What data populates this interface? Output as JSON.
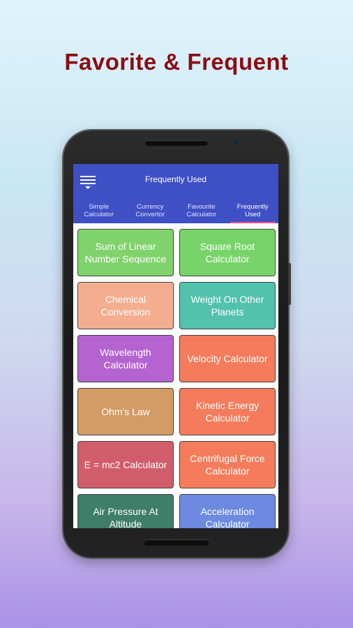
{
  "promo": {
    "title": "Favorite & Frequent"
  },
  "appbar": {
    "title": "Frequently Used",
    "menu_icon": "menu-icon"
  },
  "tabs": [
    {
      "line1": "Simple",
      "line2": "Calculator",
      "active": false
    },
    {
      "line1": "Currency",
      "line2": "Convertor",
      "active": false
    },
    {
      "line1": "Favourite",
      "line2": "Calculator",
      "active": false
    },
    {
      "line1": "Frequently",
      "line2": "Used",
      "active": true
    }
  ],
  "tiles": [
    {
      "label": "Sum of Linear Number Sequence",
      "color": "#7fd36a"
    },
    {
      "label": "Square Root Calculator",
      "color": "#78d46a"
    },
    {
      "label": "Chemical Conversion",
      "color": "#f5ad8f"
    },
    {
      "label": "Weight On Other Planets",
      "color": "#52c2ad"
    },
    {
      "label": "Wavelength Calculator",
      "color": "#b463d0"
    },
    {
      "label": "Velocity Calculator",
      "color": "#f47c5c"
    },
    {
      "label": "Ohm's Law",
      "color": "#d39b65"
    },
    {
      "label": "Kinetic Energy Calculator",
      "color": "#f47c5c"
    },
    {
      "label": "E = mc2 Calculator",
      "color": "#d15d6a"
    },
    {
      "label": "Centrifugal Force Calculator",
      "color": "#f47c5c"
    },
    {
      "label": "Air Pressure At Altitude",
      "color": "#3f7e68"
    },
    {
      "label": "Acceleration Calculator",
      "color": "#6d8ae0"
    }
  ]
}
